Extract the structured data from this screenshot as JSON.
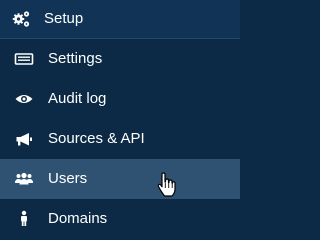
{
  "header": {
    "label": "Setup",
    "icon": "gears-icon"
  },
  "items": [
    {
      "label": "Settings",
      "icon": "keyboard-icon"
    },
    {
      "label": "Audit log",
      "icon": "eye-icon"
    },
    {
      "label": "Sources & API",
      "icon": "megaphone-icon"
    },
    {
      "label": "Users",
      "icon": "users-icon",
      "state": "hovered"
    },
    {
      "label": "Domains",
      "icon": "user-icon"
    }
  ],
  "colors": {
    "background": "#0c2a45",
    "header_background": "#113456",
    "hover_background": "#2f5272",
    "text": "#ffffff"
  }
}
